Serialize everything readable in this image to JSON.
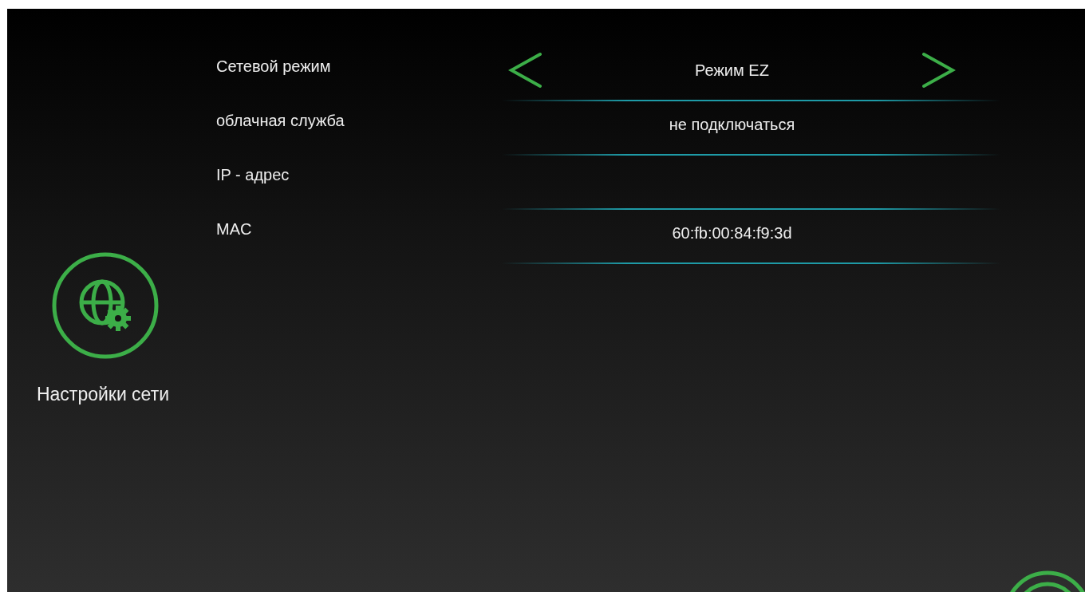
{
  "sidebar": {
    "title": "Настройки сети"
  },
  "settings": [
    {
      "label": "Сетевой режим",
      "kind": "selector",
      "value": "Режим EZ"
    },
    {
      "label": "облачная служба",
      "kind": "text",
      "value": "не подключаться"
    },
    {
      "label": "IP - адрес",
      "kind": "text"
    },
    {
      "label": "MAC",
      "kind": "text",
      "value": "60:fb:00:84:f9:3d"
    }
  ]
}
